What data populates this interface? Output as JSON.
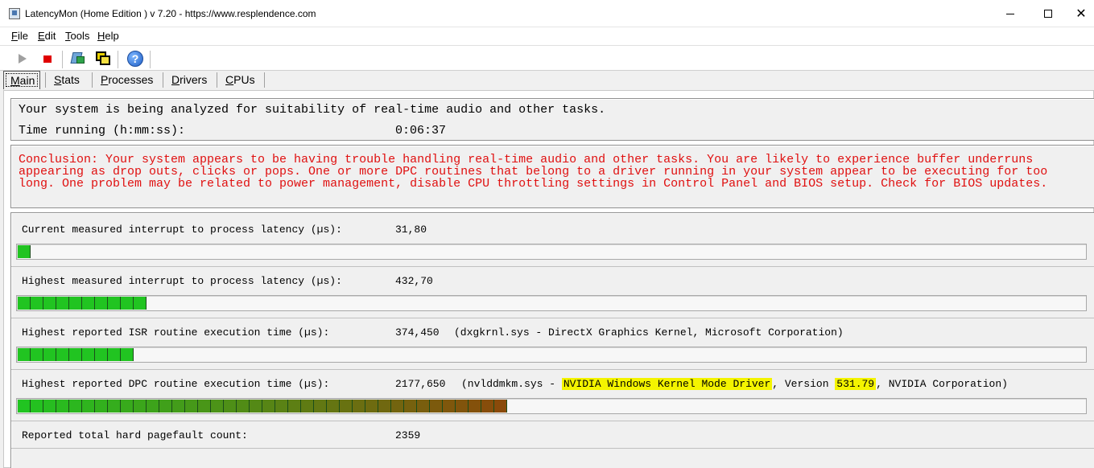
{
  "window": {
    "title": "LatencyMon  (Home Edition )  v 7.20 - https://www.resplendence.com",
    "icon": "app-icon"
  },
  "menu": [
    {
      "label": "File"
    },
    {
      "label": "Edit"
    },
    {
      "label": "Tools"
    },
    {
      "label": "Help"
    }
  ],
  "toolbar": {
    "icons": [
      "play-icon",
      "stop-icon",
      "cpu-icon",
      "windows-icon",
      "help-icon"
    ]
  },
  "tabs": [
    {
      "label": "Main"
    },
    {
      "label": "Stats"
    },
    {
      "label": "Processes"
    },
    {
      "label": "Drivers"
    },
    {
      "label": "CPUs"
    }
  ],
  "analysis": {
    "status_text": "Your system is being analyzed for suitability of real-time audio and other tasks.",
    "time_label": "Time running (h:mm:ss):",
    "time_value": "0:06:37"
  },
  "conclusion": {
    "text": "Conclusion: Your system appears to be having trouble handling real-time audio and other tasks. You are likely to experience buffer underruns appearing as drop outs, clicks or pops. One or more DPC routines that belong to a driver running in your system appear to be executing for too long. One problem may be related to power management, disable CPU throttling settings in Control Panel and BIOS setup. Check for BIOS updates.",
    "color": "#e01010"
  },
  "metrics": {
    "current_latency": {
      "label": "Current measured interrupt to process latency (µs):",
      "value": "31,80",
      "bar_segments": 1
    },
    "highest_latency": {
      "label": "Highest measured interrupt to process latency (µs):",
      "value": "432,70",
      "bar_segments": 10
    },
    "isr": {
      "label": "Highest reported ISR routine execution time (µs):",
      "value": "374,450",
      "detail": "(dxgkrnl.sys - DirectX Graphics Kernel, Microsoft Corporation)",
      "bar_segments": 9
    },
    "dpc": {
      "label": "Highest reported DPC routine execution time (µs):",
      "value": "2177,650",
      "detail_prefix": "(nvlddmkm.sys - ",
      "detail_highlight1": "NVIDIA Windows Kernel Mode Driver",
      "detail_mid": ", Version ",
      "detail_highlight2": "531.79",
      "detail_suffix": ", NVIDIA Corporation)",
      "bar_segments": 38
    },
    "pagefault": {
      "label": "Reported total hard pagefault count:",
      "value": "2359"
    }
  },
  "colors": {
    "bar_green": "#21c421",
    "bar_brown": "#8a4a0a",
    "highlight": "#f4f400"
  }
}
